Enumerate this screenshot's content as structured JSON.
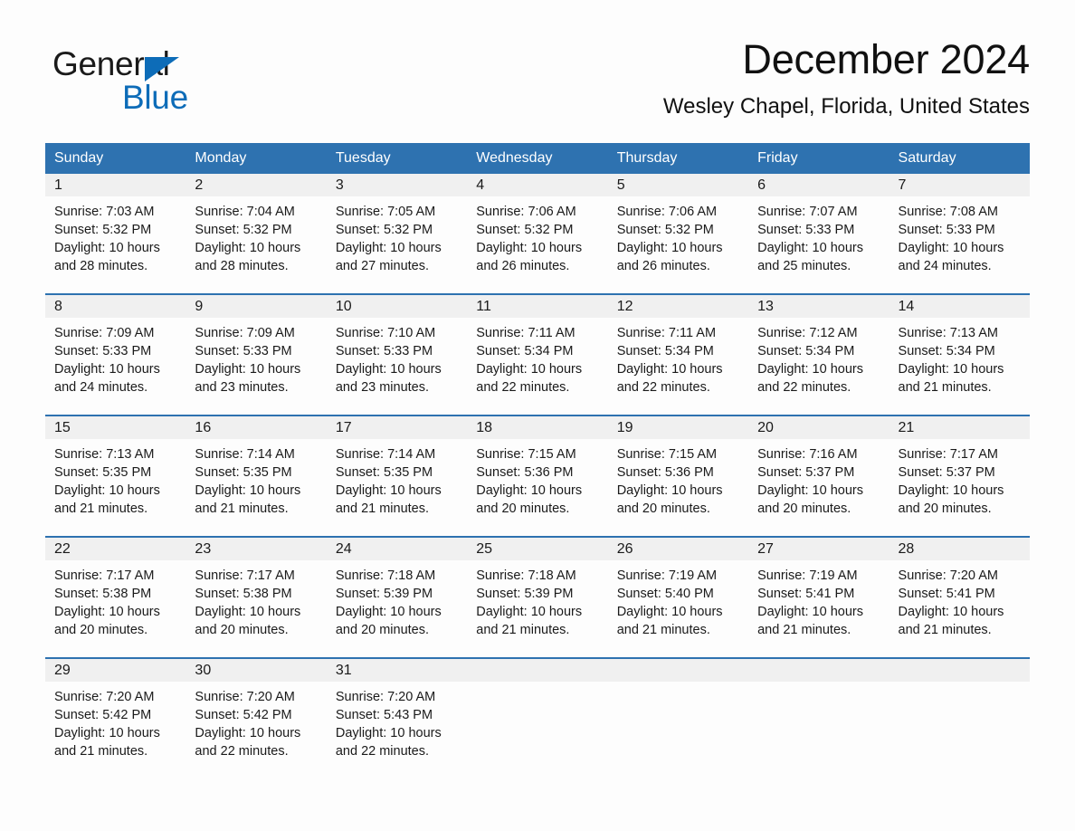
{
  "logo": {
    "word_one": "General",
    "word_two": "Blue",
    "triangle_color": "#0d6cb8",
    "icon": "triangle-icon"
  },
  "header": {
    "title": "December 2024",
    "subtitle": "Wesley Chapel, Florida, United States"
  },
  "theme": {
    "header_blue": "#2e72b0",
    "date_band_gray": "#f0f0f0",
    "page_background": "#fdfdfd",
    "text": "#1a1a1a"
  },
  "calendar": {
    "weekday_headers": [
      "Sunday",
      "Monday",
      "Tuesday",
      "Wednesday",
      "Thursday",
      "Friday",
      "Saturday"
    ],
    "weeks": [
      {
        "dates": [
          "1",
          "2",
          "3",
          "4",
          "5",
          "6",
          "7"
        ],
        "info": [
          "Sunrise: 7:03 AM\nSunset: 5:32 PM\nDaylight: 10 hours\nand 28 minutes.",
          "Sunrise: 7:04 AM\nSunset: 5:32 PM\nDaylight: 10 hours\nand 28 minutes.",
          "Sunrise: 7:05 AM\nSunset: 5:32 PM\nDaylight: 10 hours\nand 27 minutes.",
          "Sunrise: 7:06 AM\nSunset: 5:32 PM\nDaylight: 10 hours\nand 26 minutes.",
          "Sunrise: 7:06 AM\nSunset: 5:32 PM\nDaylight: 10 hours\nand 26 minutes.",
          "Sunrise: 7:07 AM\nSunset: 5:33 PM\nDaylight: 10 hours\nand 25 minutes.",
          "Sunrise: 7:08 AM\nSunset: 5:33 PM\nDaylight: 10 hours\nand 24 minutes."
        ]
      },
      {
        "dates": [
          "8",
          "9",
          "10",
          "11",
          "12",
          "13",
          "14"
        ],
        "info": [
          "Sunrise: 7:09 AM\nSunset: 5:33 PM\nDaylight: 10 hours\nand 24 minutes.",
          "Sunrise: 7:09 AM\nSunset: 5:33 PM\nDaylight: 10 hours\nand 23 minutes.",
          "Sunrise: 7:10 AM\nSunset: 5:33 PM\nDaylight: 10 hours\nand 23 minutes.",
          "Sunrise: 7:11 AM\nSunset: 5:34 PM\nDaylight: 10 hours\nand 22 minutes.",
          "Sunrise: 7:11 AM\nSunset: 5:34 PM\nDaylight: 10 hours\nand 22 minutes.",
          "Sunrise: 7:12 AM\nSunset: 5:34 PM\nDaylight: 10 hours\nand 22 minutes.",
          "Sunrise: 7:13 AM\nSunset: 5:34 PM\nDaylight: 10 hours\nand 21 minutes."
        ]
      },
      {
        "dates": [
          "15",
          "16",
          "17",
          "18",
          "19",
          "20",
          "21"
        ],
        "info": [
          "Sunrise: 7:13 AM\nSunset: 5:35 PM\nDaylight: 10 hours\nand 21 minutes.",
          "Sunrise: 7:14 AM\nSunset: 5:35 PM\nDaylight: 10 hours\nand 21 minutes.",
          "Sunrise: 7:14 AM\nSunset: 5:35 PM\nDaylight: 10 hours\nand 21 minutes.",
          "Sunrise: 7:15 AM\nSunset: 5:36 PM\nDaylight: 10 hours\nand 20 minutes.",
          "Sunrise: 7:15 AM\nSunset: 5:36 PM\nDaylight: 10 hours\nand 20 minutes.",
          "Sunrise: 7:16 AM\nSunset: 5:37 PM\nDaylight: 10 hours\nand 20 minutes.",
          "Sunrise: 7:17 AM\nSunset: 5:37 PM\nDaylight: 10 hours\nand 20 minutes."
        ]
      },
      {
        "dates": [
          "22",
          "23",
          "24",
          "25",
          "26",
          "27",
          "28"
        ],
        "info": [
          "Sunrise: 7:17 AM\nSunset: 5:38 PM\nDaylight: 10 hours\nand 20 minutes.",
          "Sunrise: 7:17 AM\nSunset: 5:38 PM\nDaylight: 10 hours\nand 20 minutes.",
          "Sunrise: 7:18 AM\nSunset: 5:39 PM\nDaylight: 10 hours\nand 20 minutes.",
          "Sunrise: 7:18 AM\nSunset: 5:39 PM\nDaylight: 10 hours\nand 21 minutes.",
          "Sunrise: 7:19 AM\nSunset: 5:40 PM\nDaylight: 10 hours\nand 21 minutes.",
          "Sunrise: 7:19 AM\nSunset: 5:41 PM\nDaylight: 10 hours\nand 21 minutes.",
          "Sunrise: 7:20 AM\nSunset: 5:41 PM\nDaylight: 10 hours\nand 21 minutes."
        ]
      },
      {
        "dates": [
          "29",
          "30",
          "31",
          "",
          "",
          "",
          ""
        ],
        "info": [
          "Sunrise: 7:20 AM\nSunset: 5:42 PM\nDaylight: 10 hours\nand 21 minutes.",
          "Sunrise: 7:20 AM\nSunset: 5:42 PM\nDaylight: 10 hours\nand 22 minutes.",
          "Sunrise: 7:20 AM\nSunset: 5:43 PM\nDaylight: 10 hours\nand 22 minutes.",
          "",
          "",
          "",
          ""
        ]
      }
    ]
  }
}
